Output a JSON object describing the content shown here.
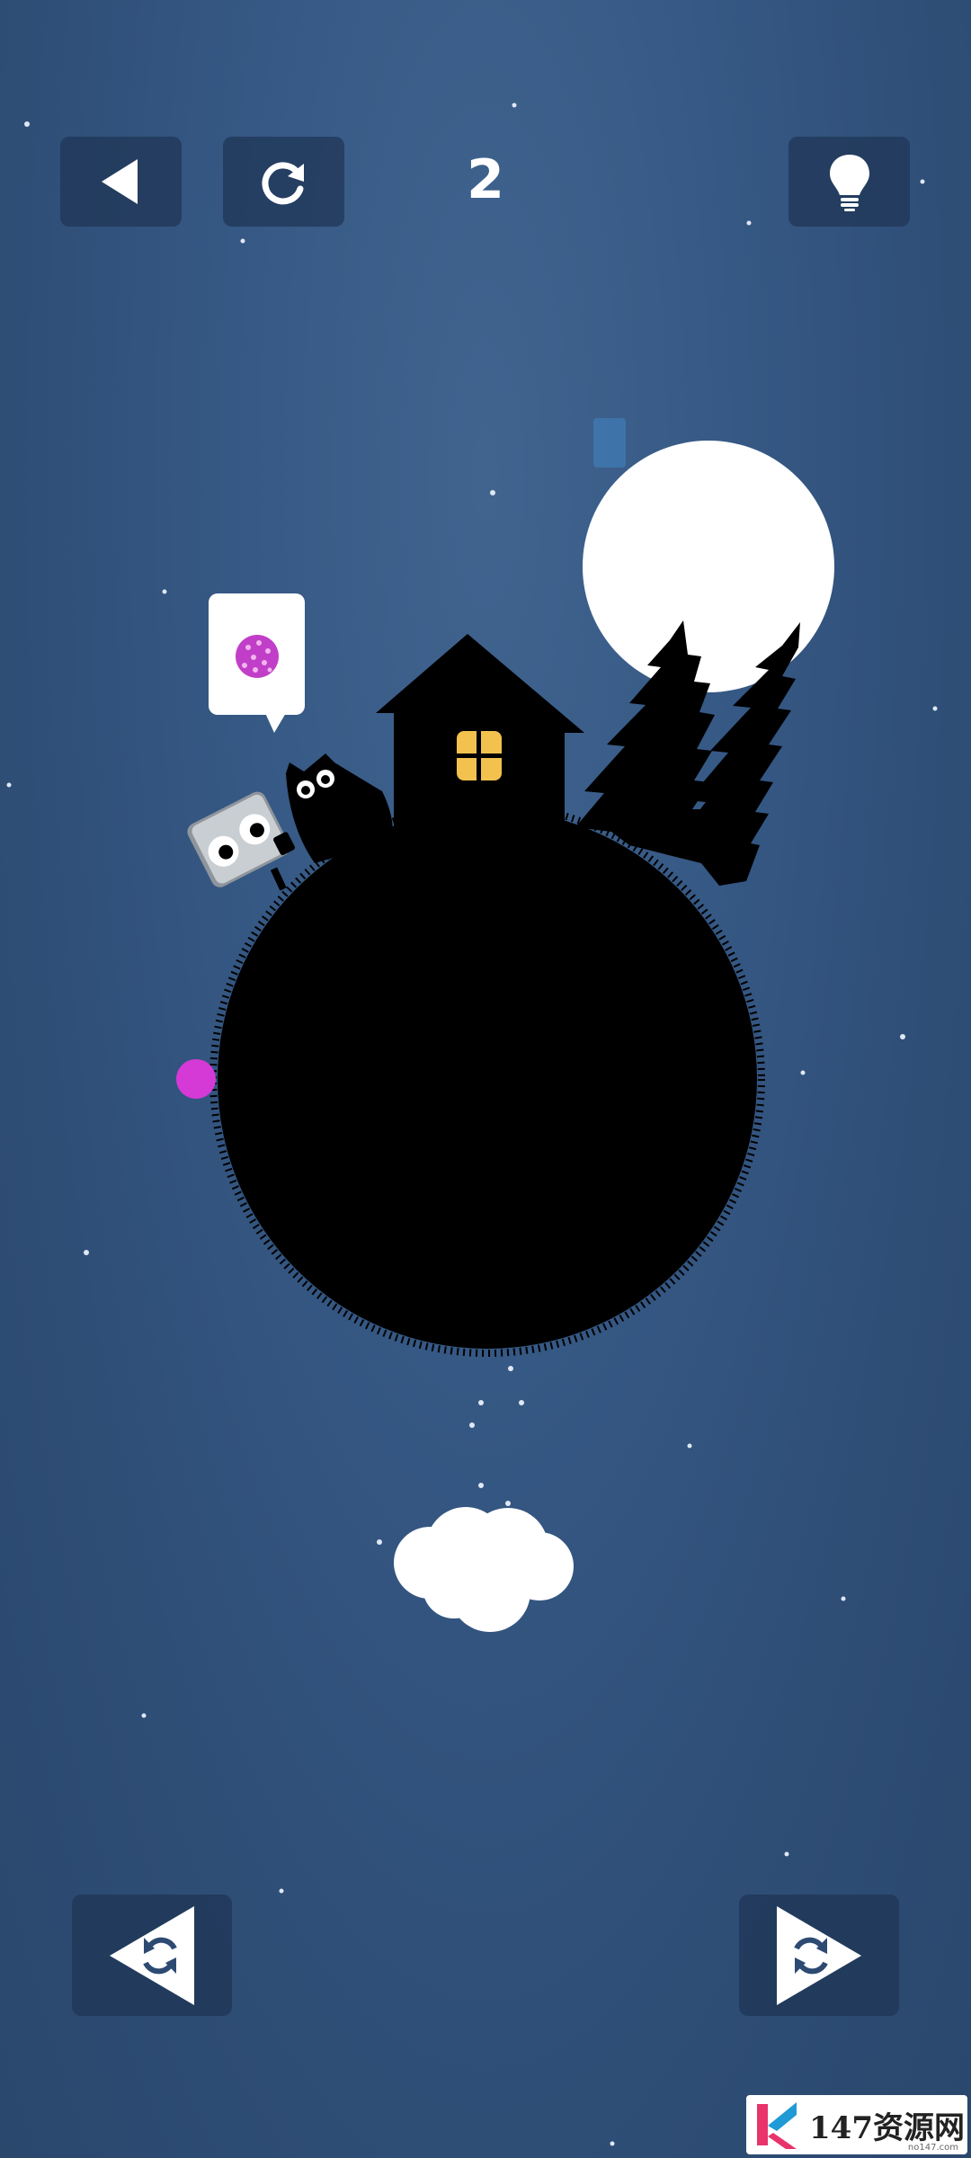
{
  "hud": {
    "level_number": "2",
    "back_icon": "back-arrow-icon",
    "reset_icon": "restart-icon",
    "hint_icon": "lightbulb-icon"
  },
  "controls": {
    "rotate_left_icon": "rotate-left-icon",
    "rotate_right_icon": "rotate-right-icon"
  },
  "scene": {
    "speech_bubble_item": "pink-spotted-ball",
    "colors": {
      "sky": "#365985",
      "planet": "#000000",
      "moon": "#ffffff",
      "window": "#f2c14e",
      "ball": "#d63ad6",
      "cloud": "#ffffff"
    }
  },
  "watermark": {
    "text": "147资源网",
    "sub": "no147.com"
  }
}
